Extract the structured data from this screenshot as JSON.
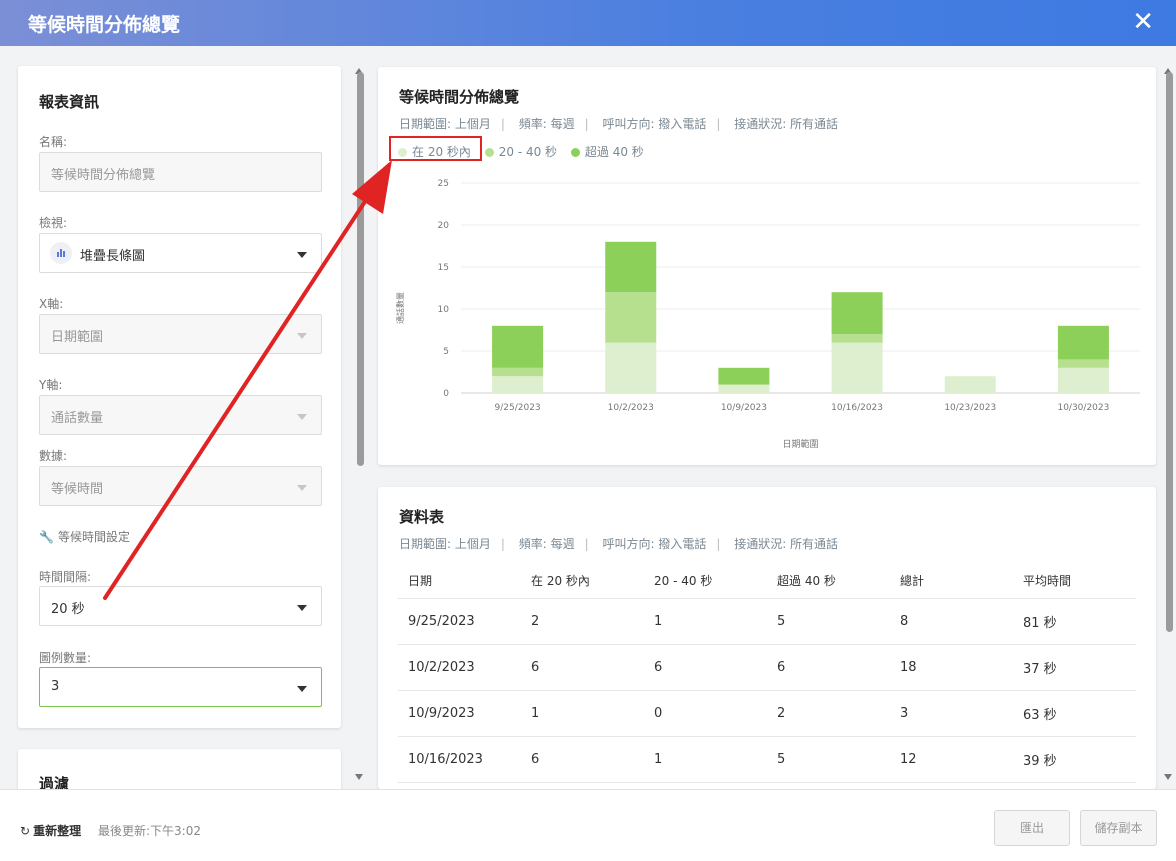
{
  "window": {
    "title": "等候時間分佈總覽",
    "close_label": "✕"
  },
  "report_info": {
    "section_title": "報表資訊",
    "name_label": "名稱:",
    "name_placeholder": "等候時間分佈總覽",
    "view_label": "檢視:",
    "view_value": "堆疊長條圖",
    "x_label": "X軸:",
    "x_value": "日期範圍",
    "y_label": "Y軸:",
    "y_value": "通話數量",
    "data_label": "數據:",
    "data_value": "等候時間",
    "wait_settings": "等候時間設定",
    "interval_label": "時間間隔:",
    "interval_value": "20 秒",
    "legend_count_label": "圖例數量:",
    "legend_count_value": "3"
  },
  "filter": {
    "section_title": "過濾"
  },
  "chart_card": {
    "title": "等候時間分佈總覽",
    "meta": [
      "日期範圍: 上個月",
      "頻率: 每週",
      "呼叫方向: 撥入電話",
      "接通狀況: 所有通話"
    ]
  },
  "table_card": {
    "title": "資料表",
    "meta": [
      "日期範圍: 上個月",
      "頻率: 每週",
      "呼叫方向: 撥入電話",
      "接通狀況: 所有通話"
    ],
    "columns": [
      "日期",
      "在 20 秒內",
      "20 - 40 秒",
      "超過 40 秒",
      "總計",
      "平均時間"
    ],
    "rows": [
      [
        "9/25/2023",
        "2",
        "1",
        "5",
        "8",
        "81 秒"
      ],
      [
        "10/2/2023",
        "6",
        "6",
        "6",
        "18",
        "37 秒"
      ],
      [
        "10/9/2023",
        "1",
        "0",
        "2",
        "3",
        "63 秒"
      ],
      [
        "10/16/2023",
        "6",
        "1",
        "5",
        "12",
        "39 秒"
      ]
    ]
  },
  "chart_data": {
    "type": "bar",
    "stacked": true,
    "categories": [
      "9/25/2023",
      "10/2/2023",
      "10/9/2023",
      "10/16/2023",
      "10/23/2023",
      "10/30/2023"
    ],
    "series": [
      {
        "name": "在 20 秒內",
        "values": [
          2,
          6,
          1,
          6,
          2,
          3
        ],
        "color": "#ddefcf"
      },
      {
        "name": "20 - 40 秒",
        "values": [
          1,
          6,
          0,
          1,
          0,
          1
        ],
        "color": "#b6df8e"
      },
      {
        "name": "超過 40 秒",
        "values": [
          5,
          6,
          2,
          5,
          0,
          4
        ],
        "color": "#8ccf59"
      }
    ],
    "xlabel": "日期範圍",
    "ylabel": "通話數量",
    "ylim": [
      0,
      25
    ],
    "yticks": [
      0,
      5,
      10,
      15,
      20,
      25
    ],
    "grid": true,
    "legend_position": "top-left"
  },
  "footer": {
    "refresh_label": "重新整理",
    "updated_text": "最後更新:下午3:02",
    "export_label": "匯出",
    "save_copy_label": "儲存副本"
  },
  "colors": {
    "accent": "#4a7fe0",
    "focus": "#7cc04d",
    "annotation": "#e02424"
  }
}
